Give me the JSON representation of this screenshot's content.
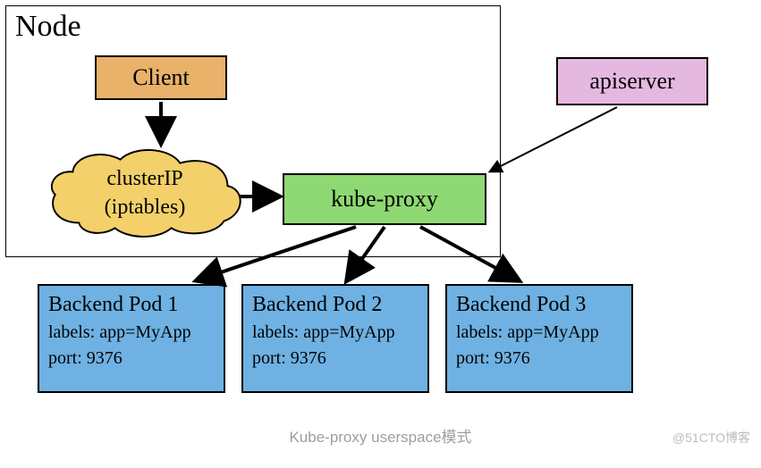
{
  "node": {
    "title": "Node"
  },
  "client": {
    "label": "Client"
  },
  "cluster": {
    "line1": "clusterIP",
    "line2": "(iptables)"
  },
  "kubeproxy": {
    "label": "kube-proxy"
  },
  "apiserver": {
    "label": "apiserver"
  },
  "pods": [
    {
      "title": "Backend Pod 1",
      "labels": "labels: app=MyApp",
      "port": "port: 9376"
    },
    {
      "title": "Backend Pod 2",
      "labels": "labels: app=MyApp",
      "port": "port: 9376"
    },
    {
      "title": "Backend Pod 3",
      "labels": "labels: app=MyApp",
      "port": "port: 9376"
    }
  ],
  "caption": "Kube-proxy userspace模式",
  "watermark": "@51CTO博客",
  "colors": {
    "client": "#e8b26a",
    "cloud": "#f3d06a",
    "kubeproxy": "#8ed973",
    "apiserver": "#e5b8e0",
    "pod": "#6eb1e2"
  }
}
